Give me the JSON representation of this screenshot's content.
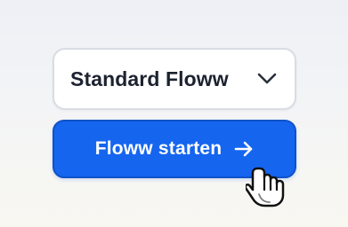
{
  "flow_select": {
    "selected_value": "Standard Floww"
  },
  "start_button": {
    "label": "Floww starten"
  },
  "icons": {
    "dropdown": "chevron-down-icon",
    "button": "arrow-right-icon",
    "cursor": "hand-pointer-cursor-icon"
  },
  "colors": {
    "accent": "#1565ef",
    "text": "#1d2230"
  }
}
